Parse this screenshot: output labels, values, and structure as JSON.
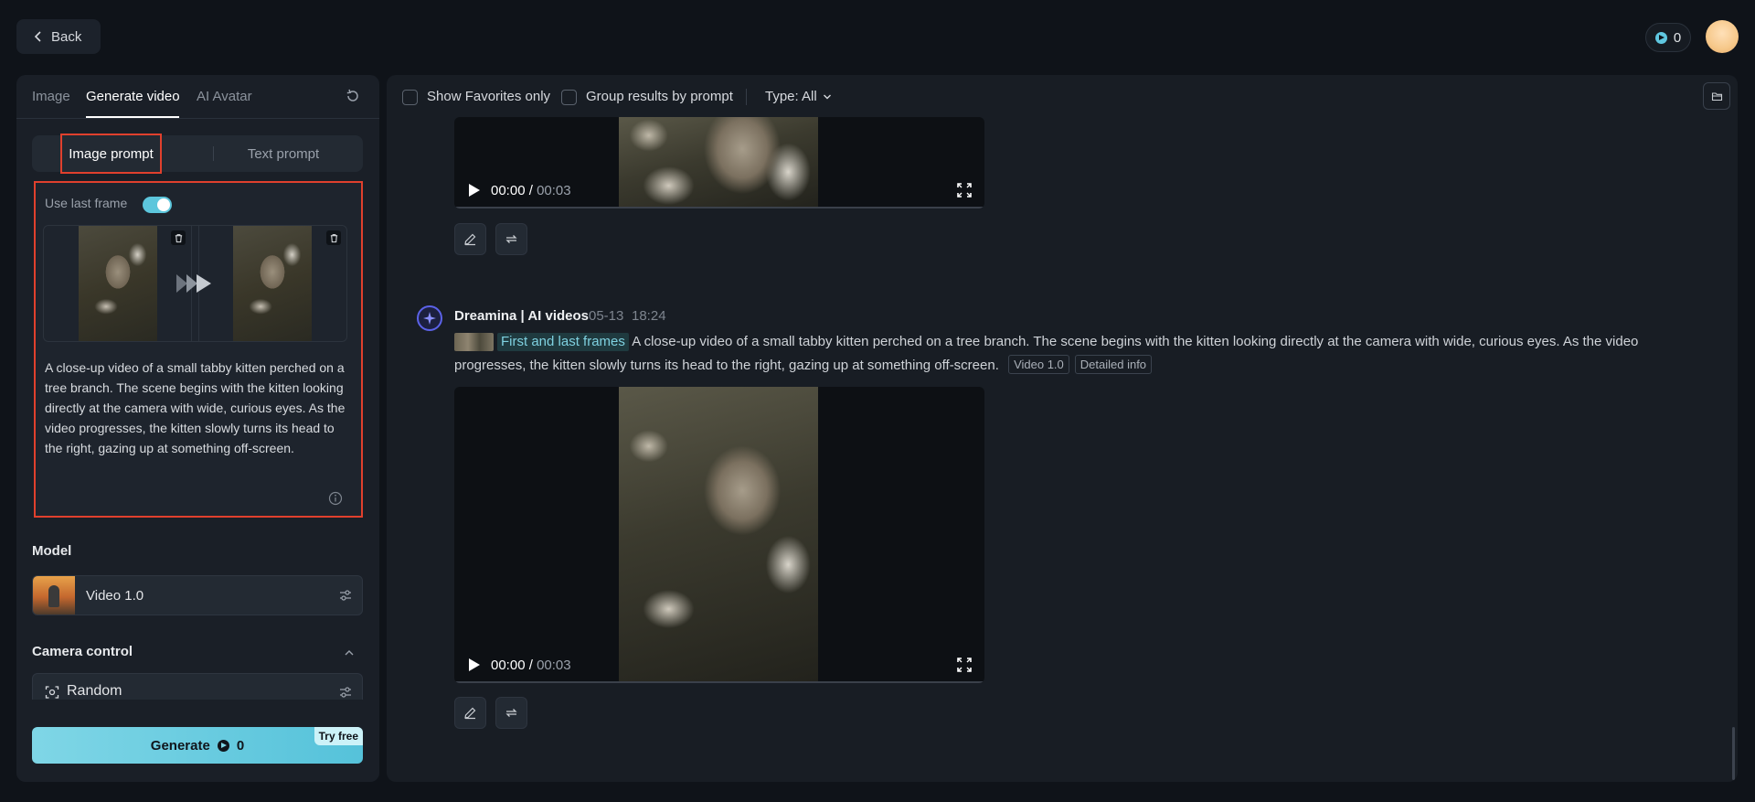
{
  "header": {
    "back_label": "Back",
    "credits": "0"
  },
  "left": {
    "tabs": [
      {
        "label": "Image"
      },
      {
        "label": "Generate video"
      },
      {
        "label": "AI Avatar"
      }
    ],
    "modes": {
      "image": "Image prompt",
      "text": "Text prompt"
    },
    "use_last_frame_label": "Use last frame",
    "use_last_frame_on": true,
    "prompt": "A close-up video of a small tabby kitten perched on a tree branch. The scene begins with the kitten looking directly at the camera with wide, curious eyes. As the video progresses, the kitten slowly turns its head to the right, gazing up at something off-screen.",
    "model_label": "Model",
    "model_name": "Video 1.0",
    "camera_label": "Camera control",
    "camera_value": "Random",
    "generate_label": "Generate",
    "generate_cost": "0",
    "try_free": "Try free"
  },
  "toolbar": {
    "favorites_label": "Show Favorites only",
    "group_label": "Group results by prompt",
    "type_label": "Type: All"
  },
  "player1": {
    "current": "00:00",
    "sep": " / ",
    "duration": "00:03"
  },
  "message": {
    "author": "Dreamina | AI videos",
    "date": "05-13",
    "time": "18:24",
    "frames_tag": "First and last frames",
    "prompt": "A close-up video of a small tabby kitten perched on a tree branch. The scene begins with the kitten looking directly at the camera with wide, curious eyes. As the video progresses, the kitten slowly turns its head to the right, gazing up at something off-screen.",
    "model_tag": "Video 1.0",
    "info_tag": "Detailed info"
  },
  "player2": {
    "current": "00:00",
    "sep": " / ",
    "duration": "00:03"
  },
  "colors": {
    "accent": "#5cc6dc",
    "highlight_border": "#e0402d",
    "background": "#0f1319"
  },
  "icons": [
    "chevron-left-icon",
    "coin-icon",
    "reset-icon",
    "trash-icon",
    "arrows-icon",
    "info-icon",
    "sliders-icon",
    "chevron-up-icon",
    "camera-focus-icon",
    "folder-icon",
    "play-icon",
    "fullscreen-icon",
    "edit-icon",
    "regenerate-icon"
  ]
}
